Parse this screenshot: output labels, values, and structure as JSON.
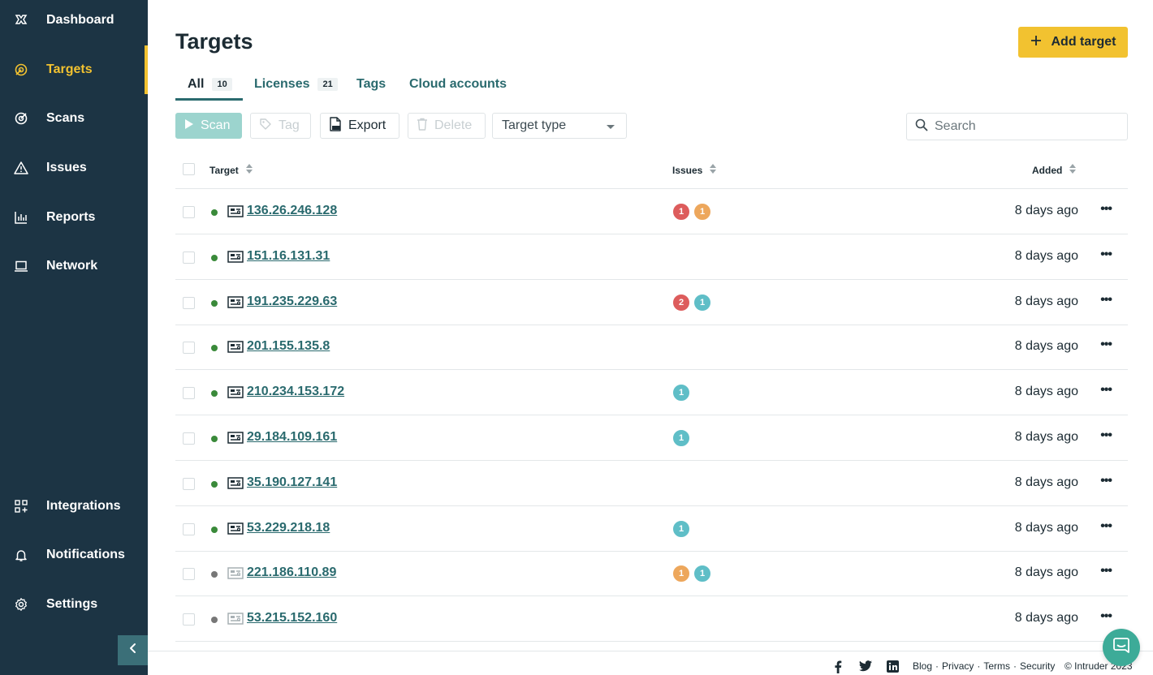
{
  "sidebar": {
    "items": [
      {
        "label": "Dashboard",
        "icon": "dashboard-icon"
      },
      {
        "label": "Targets",
        "icon": "target-icon",
        "active": true
      },
      {
        "label": "Scans",
        "icon": "scans-icon"
      },
      {
        "label": "Issues",
        "icon": "warning-icon"
      },
      {
        "label": "Reports",
        "icon": "bar-chart-icon"
      },
      {
        "label": "Network",
        "icon": "laptop-icon"
      },
      {
        "label": "Integrations",
        "icon": "grid-plus-icon"
      },
      {
        "label": "Notifications",
        "icon": "bell-icon"
      },
      {
        "label": "Settings",
        "icon": "gear-icon"
      }
    ]
  },
  "header": {
    "title": "Targets",
    "add_button": "Add target"
  },
  "tabs": [
    {
      "label": "All",
      "count": "10",
      "active": true
    },
    {
      "label": "Licenses",
      "count": "21"
    },
    {
      "label": "Tags"
    },
    {
      "label": "Cloud accounts"
    }
  ],
  "toolbar": {
    "scan": "Scan",
    "tag": "Tag",
    "export": "Export",
    "delete": "Delete",
    "target_type": "Target type",
    "search_placeholder": "Search"
  },
  "table": {
    "columns": [
      "Target",
      "Issues",
      "Added"
    ],
    "rows": [
      {
        "target": "136.26.246.128",
        "online": true,
        "issues": [
          {
            "n": "1",
            "sev": "critical"
          },
          {
            "n": "1",
            "sev": "high"
          }
        ],
        "added": "8 days ago"
      },
      {
        "target": "151.16.131.31",
        "online": true,
        "issues": [],
        "added": "8 days ago"
      },
      {
        "target": "191.235.229.63",
        "online": true,
        "issues": [
          {
            "n": "2",
            "sev": "critical"
          },
          {
            "n": "1",
            "sev": "medium"
          }
        ],
        "added": "8 days ago"
      },
      {
        "target": "201.155.135.8",
        "online": true,
        "issues": [],
        "added": "8 days ago"
      },
      {
        "target": "210.234.153.172",
        "online": true,
        "issues": [
          {
            "n": "1",
            "sev": "medium"
          }
        ],
        "added": "8 days ago"
      },
      {
        "target": "29.184.109.161",
        "online": true,
        "issues": [
          {
            "n": "1",
            "sev": "medium"
          }
        ],
        "added": "8 days ago"
      },
      {
        "target": "35.190.127.141",
        "online": true,
        "issues": [],
        "added": "8 days ago"
      },
      {
        "target": "53.229.218.18",
        "online": true,
        "issues": [
          {
            "n": "1",
            "sev": "medium"
          }
        ],
        "added": "8 days ago"
      },
      {
        "target": "221.186.110.89",
        "online": false,
        "issues": [
          {
            "n": "1",
            "sev": "high"
          },
          {
            "n": "1",
            "sev": "medium"
          }
        ],
        "added": "8 days ago"
      },
      {
        "target": "53.215.152.160",
        "online": false,
        "issues": [],
        "added": "8 days ago"
      }
    ]
  },
  "footer": {
    "links": [
      "Blog",
      "Privacy",
      "Terms",
      "Security"
    ],
    "copyright": "© Intruder 2023",
    "social": [
      "facebook-icon",
      "twitter-icon",
      "linkedin-icon"
    ]
  },
  "colors": {
    "sidebar_bg": "#1c3444",
    "accent_yellow": "#f2c230",
    "teal_link": "#2a6a6e",
    "critical": "#dd5c5c",
    "high": "#eda75c",
    "medium": "#5fbec7",
    "online": "#3a8a3a",
    "offline": "#777777"
  }
}
